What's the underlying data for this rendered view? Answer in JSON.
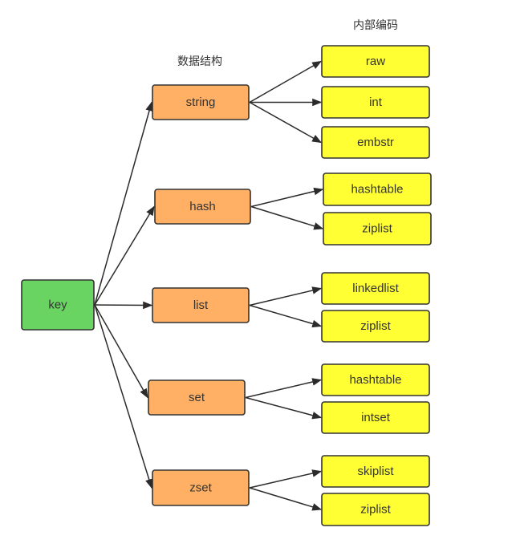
{
  "headers": {
    "data_structure": "数据结构",
    "internal_encoding": "内部编码"
  },
  "colors": {
    "key_fill": "#6ad463",
    "structure_fill": "#ffb064",
    "encoding_fill": "#ffff33",
    "border": "#333333"
  },
  "root": {
    "id": "key",
    "label": "key"
  },
  "structures": [
    {
      "id": "string",
      "label": "string",
      "encodings": [
        "raw",
        "int",
        "embstr"
      ]
    },
    {
      "id": "hash",
      "label": "hash",
      "encodings": [
        "hashtable",
        "ziplist"
      ]
    },
    {
      "id": "list",
      "label": "list",
      "encodings": [
        "linkedlist",
        "ziplist"
      ]
    },
    {
      "id": "set",
      "label": "set",
      "encodings": [
        "hashtable",
        "intset"
      ]
    },
    {
      "id": "zset",
      "label": "zset",
      "encodings": [
        "skiplist",
        "ziplist"
      ]
    }
  ]
}
